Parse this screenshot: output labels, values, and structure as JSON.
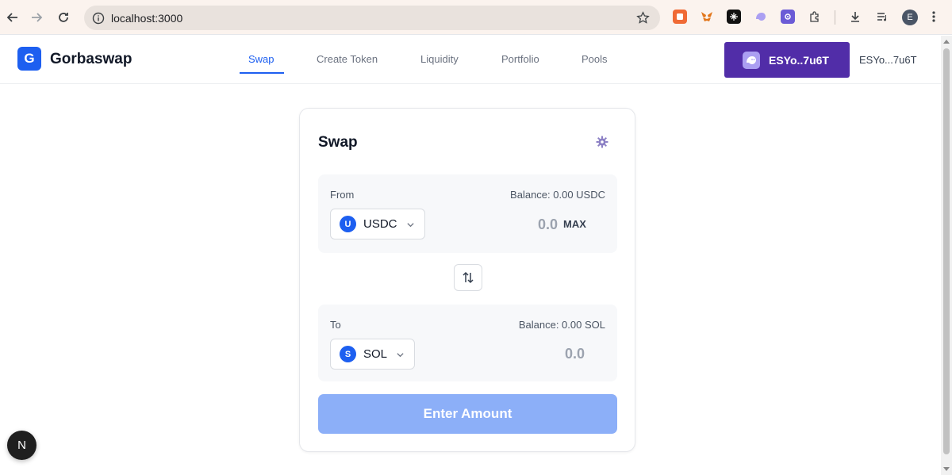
{
  "browser": {
    "url": "localhost:3000",
    "profile_initial": "E",
    "extensions": [
      "capture-extension-icon",
      "metamask-icon",
      "x-extension-icon",
      "phantom-icon",
      "gear-extension-icon",
      "puzzle-icon"
    ]
  },
  "header": {
    "logo_letter": "G",
    "brand": "Gorbaswap",
    "nav": [
      {
        "label": "Swap",
        "active": true
      },
      {
        "label": "Create Token",
        "active": false
      },
      {
        "label": "Liquidity",
        "active": false
      },
      {
        "label": "Portfolio",
        "active": false
      },
      {
        "label": "Pools",
        "active": false
      }
    ],
    "wallet_button_label": "ESYo..7u6T",
    "wallet_address": "ESYo...7u6T"
  },
  "swap": {
    "title": "Swap",
    "from": {
      "label": "From",
      "balance": "Balance: 0.00 USDC",
      "token_letter": "U",
      "token": "USDC",
      "amount": "0.0",
      "max_label": "MAX"
    },
    "to": {
      "label": "To",
      "balance": "Balance: 0.00 SOL",
      "token_letter": "S",
      "token": "SOL",
      "amount": "0.0"
    },
    "cta_label": "Enter Amount"
  },
  "next_badge": "N",
  "colors": {
    "accent": "#1d5ff0",
    "wallet": "#512da8",
    "cta_disabled": "#8caff8"
  }
}
